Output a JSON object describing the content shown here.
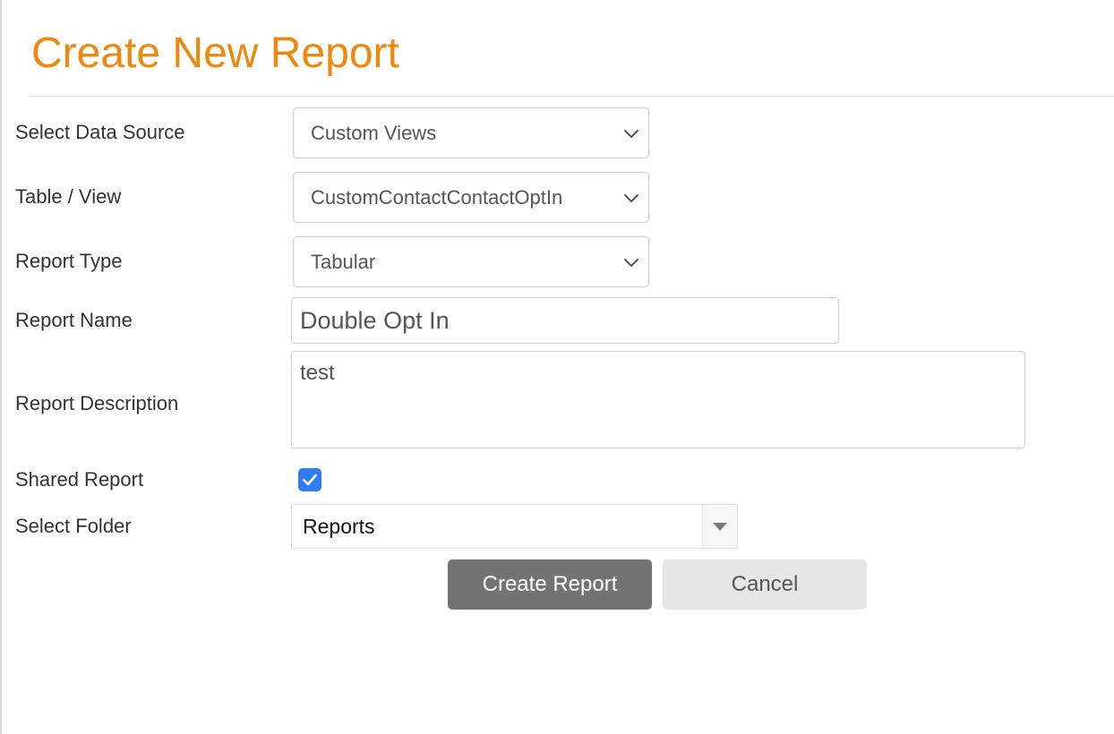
{
  "header": {
    "title": "Create New Report"
  },
  "form": {
    "data_source": {
      "label": "Select Data Source",
      "value": "Custom Views"
    },
    "table_view": {
      "label": "Table / View",
      "value": "CustomContactContactOptIn"
    },
    "report_type": {
      "label": "Report Type",
      "value": "Tabular"
    },
    "report_name": {
      "label": "Report Name",
      "value": "Double Opt In"
    },
    "report_description": {
      "label": "Report Description",
      "value": "test"
    },
    "shared_report": {
      "label": "Shared Report",
      "checked": true
    },
    "folder": {
      "label": "Select Folder",
      "value": "Reports"
    }
  },
  "actions": {
    "create_label": "Create Report",
    "cancel_label": "Cancel"
  },
  "icons": {
    "select_chevron": "chevron-down-icon",
    "folder_dropdown": "triangle-down-icon",
    "checkbox_mark": "checkmark-icon"
  },
  "colors": {
    "title": "#f0870e",
    "checkbox": "#2f7cf6",
    "primary_button": "#737373",
    "secondary_button": "#e6e6e6"
  }
}
